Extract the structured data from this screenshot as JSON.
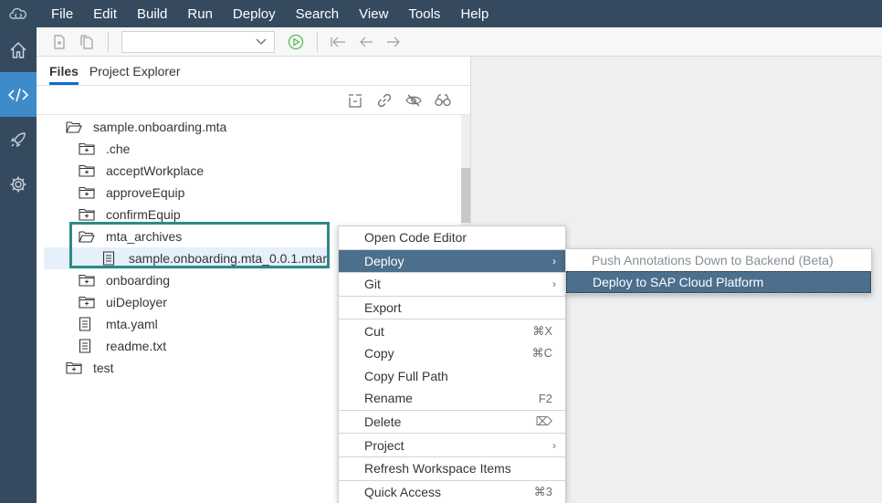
{
  "menubar": {
    "logo_icon": "cloud-code-icon",
    "items": [
      "File",
      "Edit",
      "Build",
      "Run",
      "Deploy",
      "Search",
      "View",
      "Tools",
      "Help"
    ]
  },
  "siderail": {
    "items": [
      {
        "icon": "home-icon",
        "active": false
      },
      {
        "icon": "code-icon",
        "active": true
      },
      {
        "icon": "rocket-icon",
        "active": false
      },
      {
        "icon": "gear-icon",
        "active": false
      }
    ]
  },
  "files_pane": {
    "tabs": [
      "Files",
      "Project Explorer"
    ],
    "active_tab": "Files"
  },
  "tree": [
    {
      "label": "sample.onboarding.mta",
      "type": "folder-open",
      "level": 0
    },
    {
      "label": ".che",
      "type": "folder",
      "level": 1
    },
    {
      "label": "acceptWorkplace",
      "type": "folder",
      "level": 1
    },
    {
      "label": "approveEquip",
      "type": "folder",
      "level": 1
    },
    {
      "label": "confirmEquip",
      "type": "folder",
      "level": 1
    },
    {
      "label": "mta_archives",
      "type": "folder-open",
      "level": 1
    },
    {
      "label": "sample.onboarding.mta_0.0.1.mtar",
      "type": "file",
      "level": 2,
      "selected": true
    },
    {
      "label": "onboarding",
      "type": "folder",
      "level": 1
    },
    {
      "label": "uiDeployer",
      "type": "folder",
      "level": 1
    },
    {
      "label": "mta.yaml",
      "type": "file",
      "level": 1
    },
    {
      "label": "readme.txt",
      "type": "file",
      "level": 1
    },
    {
      "label": "test",
      "type": "folder",
      "level": 0
    }
  ],
  "context_menu": {
    "groups": [
      [
        {
          "label": "Open Code Editor"
        }
      ],
      [
        {
          "label": "Deploy",
          "submenu": true,
          "active": true
        }
      ],
      [
        {
          "label": "Git",
          "submenu": true
        }
      ],
      [
        {
          "label": "Export"
        }
      ],
      [
        {
          "label": "Cut",
          "shortcut": "⌘X"
        },
        {
          "label": "Copy",
          "shortcut": "⌘C"
        },
        {
          "label": "Copy Full Path"
        },
        {
          "label": "Rename",
          "shortcut": "F2"
        }
      ],
      [
        {
          "label": "Delete",
          "shortcut": "⌦"
        }
      ],
      [
        {
          "label": "Project",
          "submenu": true
        }
      ],
      [
        {
          "label": "Refresh Workspace Items"
        }
      ],
      [
        {
          "label": "Quick Access",
          "shortcut": "⌘3"
        }
      ]
    ],
    "submenu_arrow": "›"
  },
  "sub_menu": {
    "items": [
      {
        "label": "Push Annotations Down to Backend (Beta)",
        "disabled": true
      },
      {
        "label": "Deploy to SAP Cloud Platform",
        "active": true
      }
    ]
  },
  "colors": {
    "shell": "#354a5f",
    "accent": "#0a6ed1",
    "highlight_box": "#2c8a87",
    "menu_active": "#4b6f8d",
    "run_icon": "#5cb85c"
  }
}
